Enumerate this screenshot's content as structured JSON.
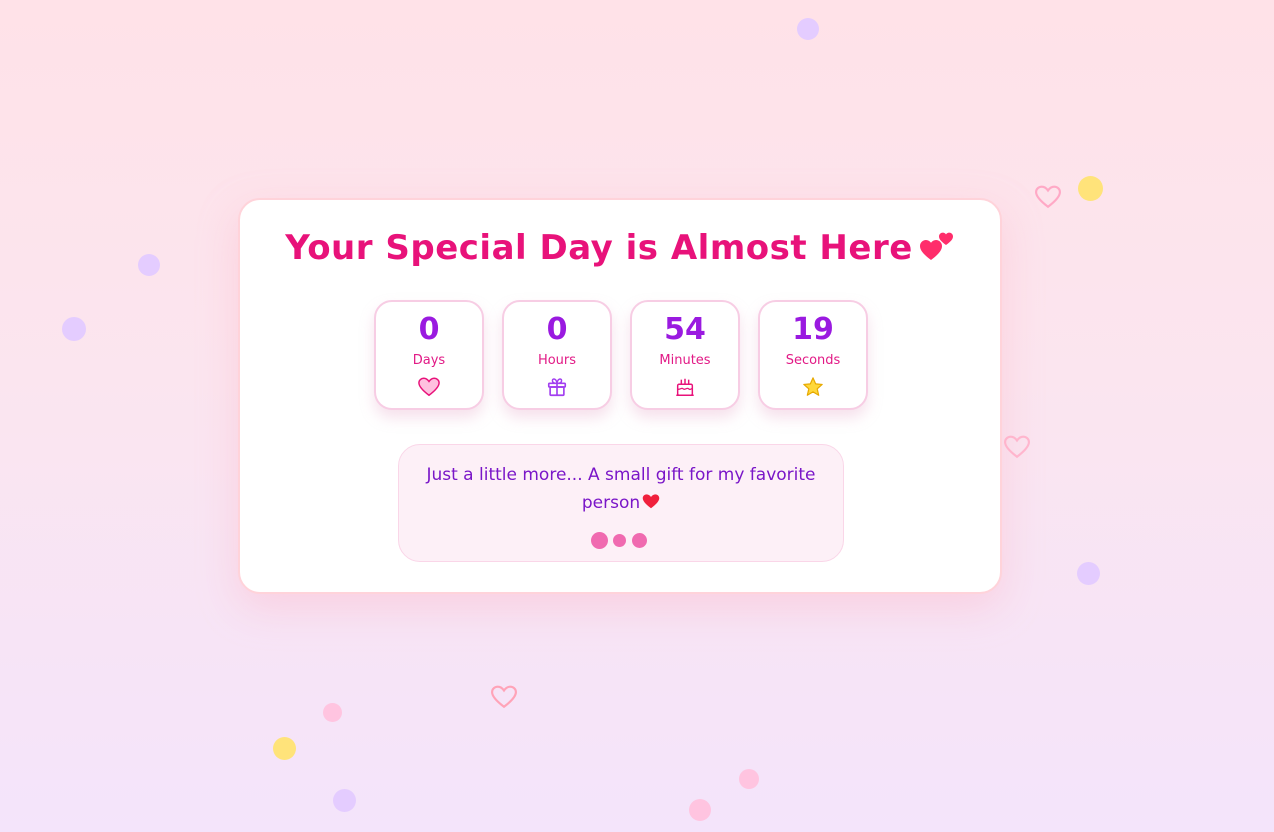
{
  "page": {
    "title": "Your Special Day is Almost Here"
  },
  "countdown": [
    {
      "value": "0",
      "label": "Days",
      "icon": "heart-icon"
    },
    {
      "value": "0",
      "label": "Hours",
      "icon": "gift-icon"
    },
    {
      "value": "54",
      "label": "Minutes",
      "icon": "cake-icon"
    },
    {
      "value": "19",
      "label": "Seconds",
      "icon": "star-icon"
    }
  ],
  "message": {
    "text": "Just a little more... A small gift for my favorite person"
  },
  "colors": {
    "title": "#e8127a",
    "number": "#9a1ae0",
    "label": "#e21a86",
    "message_text": "#7a16c8",
    "card_border": "#ffd3da"
  }
}
